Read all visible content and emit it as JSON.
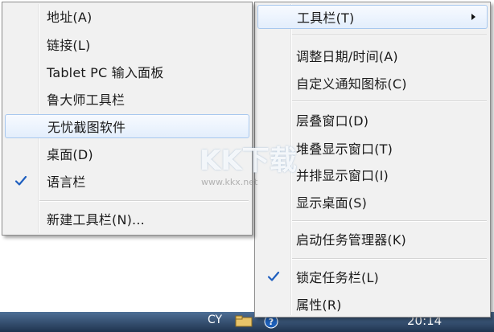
{
  "main_menu": {
    "items": [
      {
        "label": "工具栏(T)"
      },
      {
        "label": "调整日期/时间(A)"
      },
      {
        "label": "自定义通知图标(C)"
      },
      {
        "label": "层叠窗口(D)"
      },
      {
        "label": "堆叠显示窗口(T)"
      },
      {
        "label": "并排显示窗口(I)"
      },
      {
        "label": "显示桌面(S)"
      },
      {
        "label": "启动任务管理器(K)"
      },
      {
        "label": "锁定任务栏(L)"
      },
      {
        "label": "属性(R)"
      }
    ]
  },
  "toolbar_submenu": {
    "items": [
      {
        "label": "地址(A)"
      },
      {
        "label": "链接(L)"
      },
      {
        "label": "Tablet PC 输入面板"
      },
      {
        "label": "鲁大师工具栏"
      },
      {
        "label": "无忧截图软件"
      },
      {
        "label": "桌面(D)"
      },
      {
        "label": "语言栏"
      },
      {
        "label": "新建工具栏(N)..."
      }
    ]
  },
  "taskbar": {
    "language": "CY",
    "clock_time": "20:14"
  },
  "watermark": {
    "logo": "KK下载",
    "url": "www.kkx.net"
  },
  "colors": {
    "highlight_border": "#a8c8ee",
    "check_color": "#1f5fbf",
    "taskbar": "#2b4466"
  }
}
